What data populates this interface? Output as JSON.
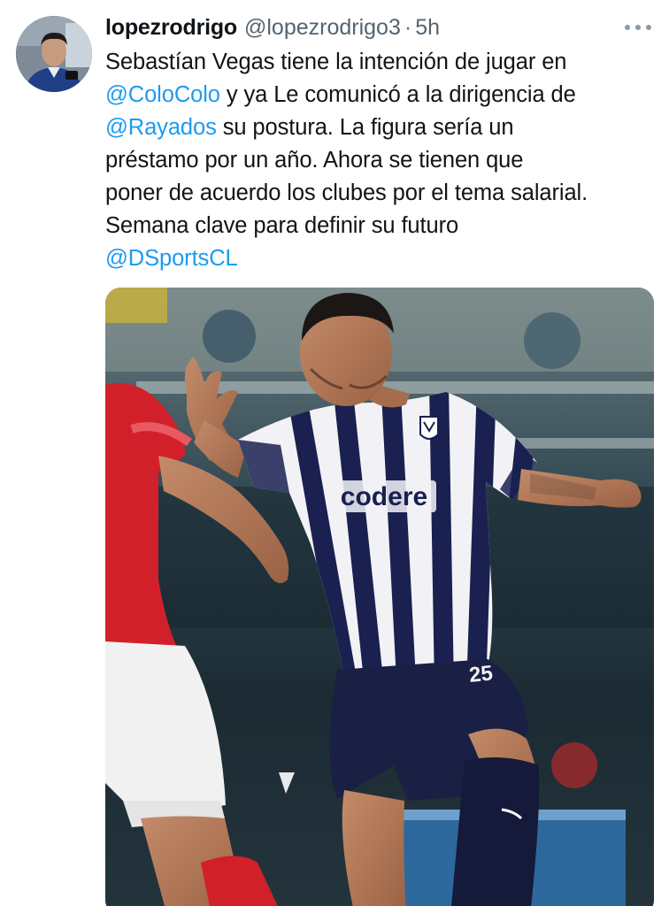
{
  "author": {
    "display_name": "lopezrodrigo",
    "handle": "@lopezrodrigo3",
    "separator": "·",
    "time": "5h",
    "avatar_icon": "profile-photo"
  },
  "more_icon": "ellipsis-icon",
  "text": {
    "l1": "Sebastían Vegas tiene la intención de jugar en",
    "l2_mention": "@ColoColo",
    "l2_rest": " y ya Le comunicó a la dirigencia de",
    "l3_mention": "@Rayados",
    "l3_rest": " su postura. La figura sería un",
    "l4": "préstamo por un año. Ahora se tienen que",
    "l5": "poner de acuerdo los clubes por el tema salarial.",
    "l6": "Semana clave para definir su futuro",
    "l7_mention": "@DSportsCL"
  },
  "media": {
    "sponsor": "codere",
    "number": "25"
  },
  "colors": {
    "link": "#1d9bf0",
    "muted": "#536471",
    "text": "#0f1419"
  }
}
